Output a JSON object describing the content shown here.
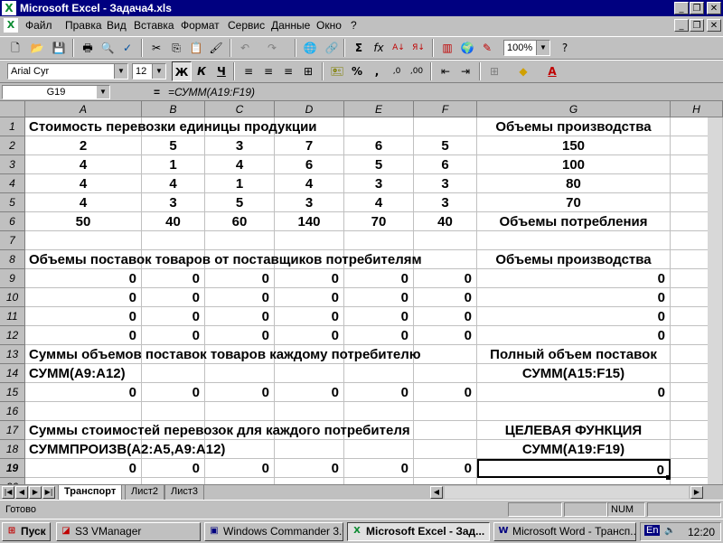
{
  "window": {
    "title": "Microsoft Excel - Задача4.xls"
  },
  "menu": [
    "Файл",
    "Правка",
    "Вид",
    "Вставка",
    "Формат",
    "Сервис",
    "Данные",
    "Окно",
    "?"
  ],
  "toolbar": {
    "zoom": "100%",
    "font": "Arial Cyr",
    "size": "12",
    "bold": "Ж",
    "italic": "К",
    "underline": "Ч",
    "percent": "%",
    "comma": ","
  },
  "formula_bar": {
    "name_box": "G19",
    "eq": "=",
    "formula": "=СУММ(A19:F19)"
  },
  "columns": [
    "A",
    "B",
    "C",
    "D",
    "E",
    "F",
    "G",
    "H"
  ],
  "rows": [
    "1",
    "2",
    "3",
    "4",
    "5",
    "6",
    "7",
    "8",
    "9",
    "10",
    "11",
    "12",
    "13",
    "14",
    "15",
    "16",
    "17",
    "18",
    "19",
    "20"
  ],
  "cells": {
    "r1": {
      "A": "Стоимость перевозки единицы продукции",
      "G": "Объемы производства"
    },
    "r2": {
      "A": "2",
      "B": "5",
      "C": "3",
      "D": "7",
      "E": "6",
      "F": "5",
      "G": "150"
    },
    "r3": {
      "A": "4",
      "B": "1",
      "C": "4",
      "D": "6",
      "E": "5",
      "F": "6",
      "G": "100"
    },
    "r4": {
      "A": "4",
      "B": "4",
      "C": "1",
      "D": "4",
      "E": "3",
      "F": "3",
      "G": "80"
    },
    "r5": {
      "A": "4",
      "B": "3",
      "C": "5",
      "D": "3",
      "E": "4",
      "F": "3",
      "G": "70"
    },
    "r6": {
      "A": "50",
      "B": "40",
      "C": "60",
      "D": "140",
      "E": "70",
      "F": "40",
      "G": "Объемы потребления"
    },
    "r8": {
      "A": "Объемы поставок товаров от поставщиков потребителям",
      "G": "Объемы производства"
    },
    "r9": {
      "A": "0",
      "B": "0",
      "C": "0",
      "D": "0",
      "E": "0",
      "F": "0",
      "G": "0"
    },
    "r10": {
      "A": "0",
      "B": "0",
      "C": "0",
      "D": "0",
      "E": "0",
      "F": "0",
      "G": "0"
    },
    "r11": {
      "A": "0",
      "B": "0",
      "C": "0",
      "D": "0",
      "E": "0",
      "F": "0",
      "G": "0"
    },
    "r12": {
      "A": "0",
      "B": "0",
      "C": "0",
      "D": "0",
      "E": "0",
      "F": "0",
      "G": "0"
    },
    "r13": {
      "A": "Суммы объемов поставок товаров каждому потребителю",
      "G": "Полный объем поставок"
    },
    "r14": {
      "A": "СУММ(A9:A12)",
      "G": "СУММ(A15:F15)"
    },
    "r15": {
      "A": "0",
      "B": "0",
      "C": "0",
      "D": "0",
      "E": "0",
      "F": "0",
      "G": "0"
    },
    "r17": {
      "A": "Суммы стоимостей перевозок для каждого потребителя",
      "G": "ЦЕЛЕВАЯ ФУНКЦИЯ"
    },
    "r18": {
      "A": "СУММПРОИЗВ(A2:A5,A9:A12)",
      "G": "СУММ(A19:F19)"
    },
    "r19": {
      "A": "0",
      "B": "0",
      "C": "0",
      "D": "0",
      "E": "0",
      "F": "0",
      "G": "0"
    }
  },
  "sheets": [
    "Транспорт",
    "Лист2",
    "Лист3"
  ],
  "status": {
    "ready": "Готово",
    "num": "NUM"
  },
  "taskbar": {
    "start": "Пуск",
    "items": [
      "S3 VManager",
      "Windows Commander 3.0...",
      "Microsoft Excel - Зад...",
      "Microsoft Word - Трансп..."
    ],
    "lang": "En",
    "clock": "12:20"
  }
}
